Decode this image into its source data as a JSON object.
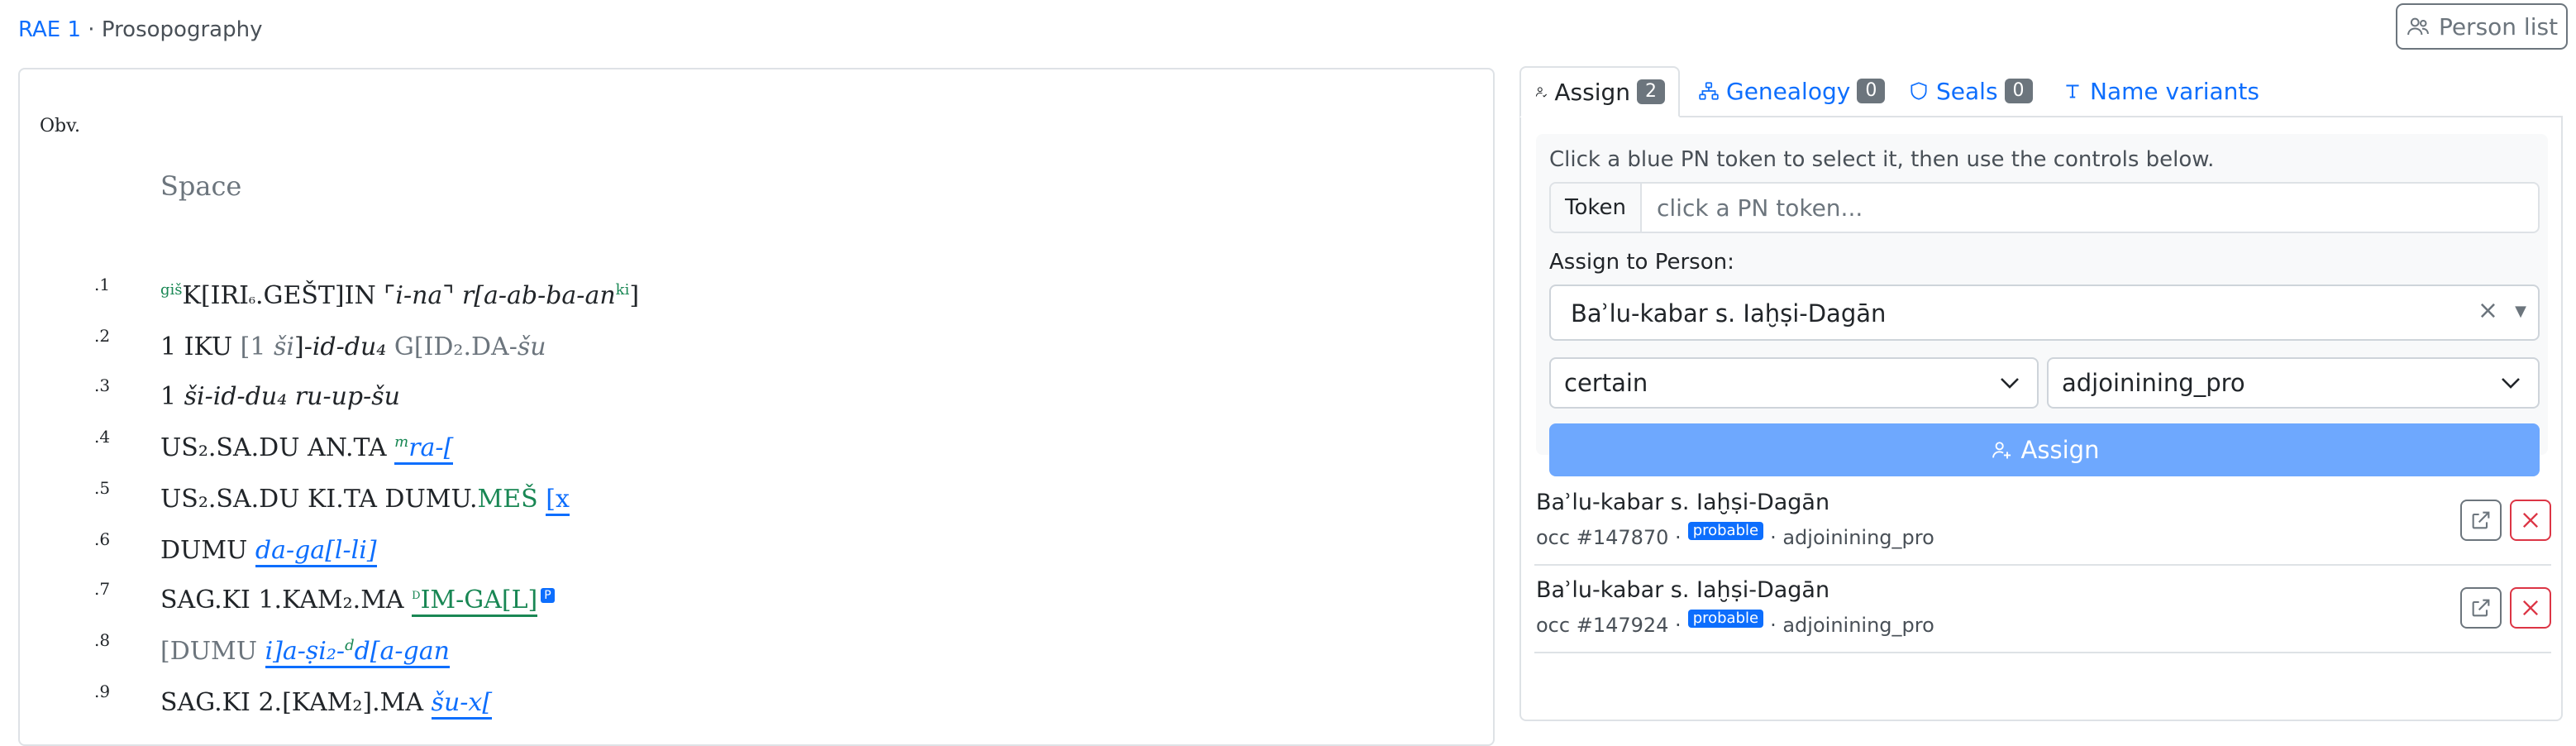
{
  "breadcrumb": {
    "link": "RAE 1",
    "separator": " · ",
    "current": "Prosopography"
  },
  "header": {
    "person_list_label": "Person list"
  },
  "text_panel": {
    "side_label": "Obv.",
    "space_label": "Space",
    "lines": [
      {
        "num": ".1"
      },
      {
        "num": ".2"
      },
      {
        "num": ".3"
      },
      {
        "num": ".4"
      },
      {
        "num": ".5"
      },
      {
        "num": ".6"
      },
      {
        "num": ".7"
      },
      {
        "num": ".8"
      },
      {
        "num": ".9"
      }
    ],
    "tokens": {
      "l1_det": "giš",
      "l1_a": "K[IRI",
      "l1_b": "₆",
      "l1_c": ".GEŠT]IN",
      "l1_d": " ⌜",
      "l1_e": "i-na",
      "l1_f": "⌝ ",
      "l1_g": "r[a-ab-ba-an",
      "l1_det2": "ki",
      "l1_h": "]",
      "l2_a": "1  ",
      "l2_b": "IKU",
      "l2_c": "  [1  ",
      "l2_d": "ši",
      "l2_e": "]-",
      "l2_f": "id-du₄",
      "l2_g": "  G[ID₂.DA-",
      "l2_h": "šu",
      "l3_a": "1  ",
      "l3_b": "ši-id-du₄",
      "l3_c": "  ",
      "l3_d": "ru-up-šu",
      "l4_a": "US₂.SA.DU  AN.TA  ",
      "l4_det": "m",
      "l4_pn": "ra-[",
      "l5_a": "US₂.SA.DU  KI.TA  DUMU.",
      "l5_b": "MEŠ",
      "l5_c": "  ",
      "l5_pn": "[x",
      "l6_a": "DUMU  ",
      "l6_pn": "da-ga[l-li]",
      "l7_a": "SAG.KI  1.KAM₂.MA  ",
      "l7_det": "d",
      "l7_pn": "IM-GA[L]",
      "l7_badge": "P",
      "l8_a": "[DUMU  ",
      "l8_pn": "i]a-ṣi₂-",
      "l8_det": "d",
      "l8_pn2": "d[a-gan",
      "l9_a": "SAG.KI  2.[KAM₂].MA  ",
      "l9_pn": "šu-x["
    }
  },
  "tabs": [
    {
      "label": "Assign",
      "count": "2",
      "active": true
    },
    {
      "label": "Genealogy",
      "count": "0"
    },
    {
      "label": "Seals",
      "count": "0"
    },
    {
      "label": "Name variants"
    }
  ],
  "assign": {
    "hint": "Click a blue PN token to select it, then use the controls below.",
    "token_label": "Token",
    "token_placeholder": "click a PN token...",
    "assign_to_label": "Assign to Person:",
    "person_value": "Baʾlu-kabar s. Iaḫṣi-Dagān",
    "certainty_value": "certain",
    "role_value": "adjoinining_pro",
    "button_label": "Assign"
  },
  "occurrences": [
    {
      "name": "Baʾlu-kabar s. Iaḫṣi-Dagān",
      "occ": "occ #147870 ·",
      "badge": "probable",
      "role": "· adjoinining_pro"
    },
    {
      "name": "Baʾlu-kabar s. Iaḫṣi-Dagān",
      "occ": "occ #147924 ·",
      "badge": "probable",
      "role": "· adjoinining_pro"
    }
  ],
  "colors": {
    "accent": "#0d6efd",
    "determinative": "#198754",
    "danger": "#dc3545",
    "button_disabled": "#6ea8fe"
  }
}
